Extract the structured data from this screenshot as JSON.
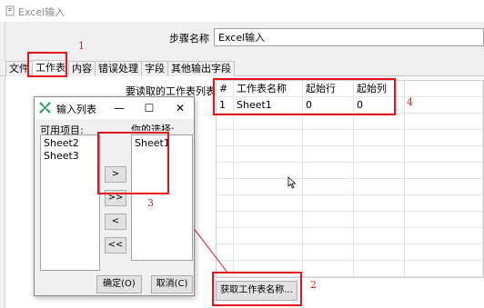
{
  "window": {
    "title": "Excel输入"
  },
  "step": {
    "label": "步骤名称",
    "value": "Excel输入"
  },
  "tabs": [
    {
      "label": "文件",
      "active": false
    },
    {
      "label": "工作表",
      "active": true
    },
    {
      "label": "内容",
      "active": false
    },
    {
      "label": "错误处理",
      "active": false
    },
    {
      "label": "字段",
      "active": false
    },
    {
      "label": "其他输出字段",
      "active": false
    }
  ],
  "sheets": {
    "label": "要读取的工作表列表",
    "columns": [
      "#",
      "工作表名称",
      "起始行",
      "起始列"
    ],
    "rows": [
      [
        "1",
        "Sheet1",
        "0",
        "0"
      ]
    ]
  },
  "fetch_button": "获取工作表名称...",
  "dialog": {
    "title": "输入列表",
    "available_label": "可用项目:",
    "available_items": [
      "Sheet2",
      "Sheet3"
    ],
    "chosen_label": "你的选择:",
    "chosen_items": [
      "Sheet1"
    ],
    "move_buttons": [
      ">",
      ">>",
      "<",
      "<<"
    ],
    "ok": "确定(O)",
    "cancel": "取消(C)",
    "controls": {
      "minimize": "—",
      "maximize": "☐",
      "close": "✕"
    }
  },
  "annotations": [
    "1",
    "2",
    "3",
    "4"
  ],
  "colors": {
    "highlight": "#e8111a",
    "dialog_icon": "#1e9c5a"
  }
}
